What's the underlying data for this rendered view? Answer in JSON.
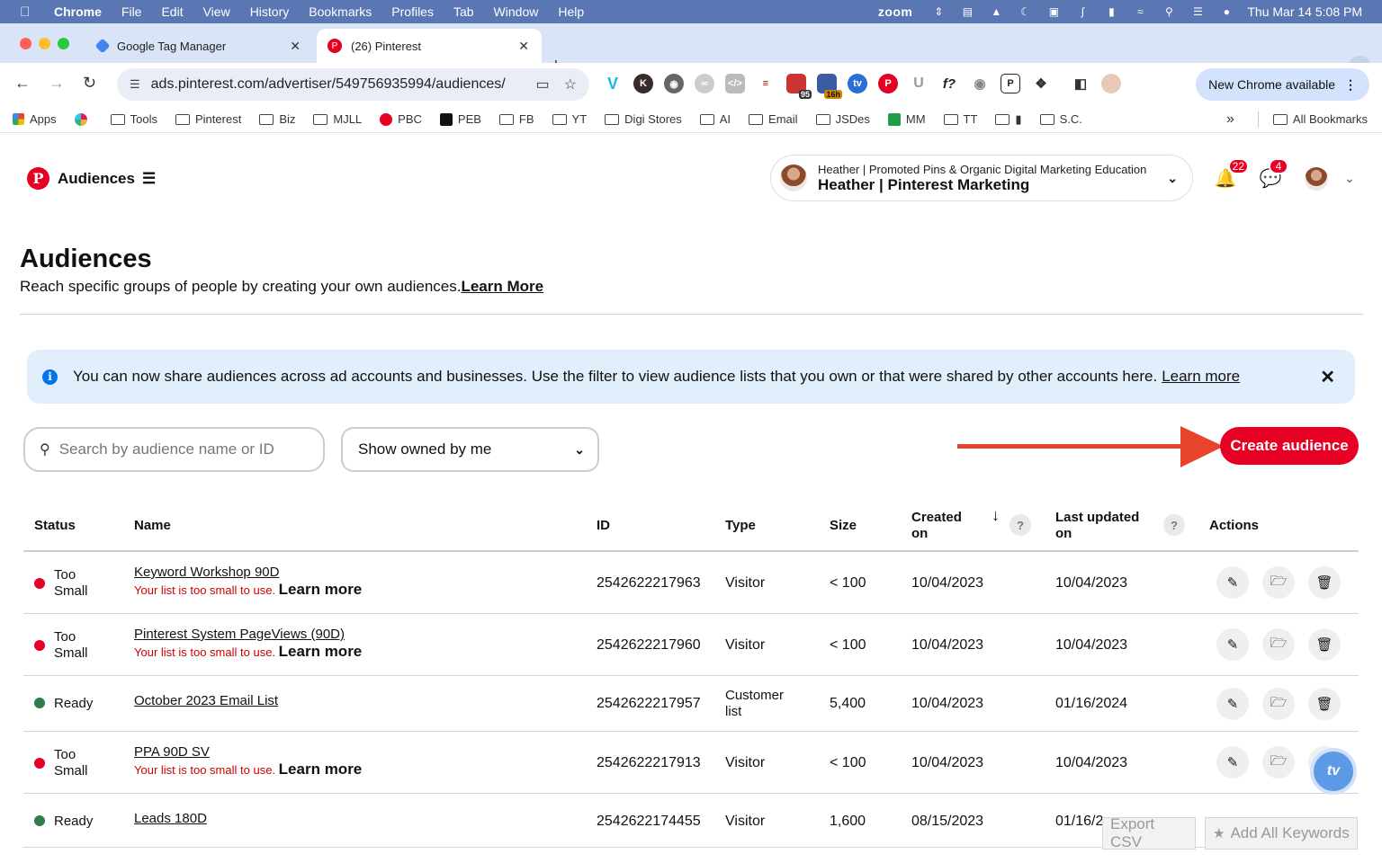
{
  "macbar": {
    "app": "Chrome",
    "menus": [
      "File",
      "Edit",
      "View",
      "History",
      "Bookmarks",
      "Profiles",
      "Tab",
      "Window",
      "Help"
    ],
    "zoom": "zoom",
    "datetime": "Thu Mar 14  5:08 PM"
  },
  "tabs": [
    {
      "title": "Google Tag Manager"
    },
    {
      "title": "(26) Pinterest"
    }
  ],
  "omnibox": {
    "url": "ads.pinterest.com/advertiser/549756935994/audiences/"
  },
  "toolbar": {
    "new_chrome": "New Chrome available",
    "ext_badges": [
      "95",
      "16h"
    ]
  },
  "bookmarks": {
    "items": [
      "Apps",
      "Tools",
      "Pinterest",
      "Biz",
      "MJLL",
      "PBC",
      "PEB",
      "FB",
      "YT",
      "Digi Stores",
      "AI",
      "Email",
      "JSDes",
      "MM",
      "TT",
      "",
      "S.C."
    ],
    "more": "»",
    "all": "All Bookmarks"
  },
  "header": {
    "brand_icon": "P",
    "section": "Audiences",
    "account_line1": "Heather | Promoted Pins & Organic Digital Marketing Education",
    "account_line2": "Heather | Pinterest Marketing",
    "notifications_count": "22",
    "messages_count": "4"
  },
  "page": {
    "title": "Audiences",
    "subtitle": "Reach specific groups of people by creating your own audiences.",
    "subtitle_link": "Learn More"
  },
  "banner": {
    "text": "You can now share audiences across ad accounts and businesses. Use the filter to view audience lists that you own or that were shared by other accounts here.",
    "link": "Learn more"
  },
  "filters": {
    "search_placeholder": "Search by audience name or ID",
    "owner_select": "Show owned by me",
    "create_button": "Create audience"
  },
  "table": {
    "headers": {
      "status": "Status",
      "name": "Name",
      "id": "ID",
      "type": "Type",
      "size": "Size",
      "created_1": "Created",
      "created_2": "on",
      "updated_1": "Last updated",
      "updated_2": "on",
      "actions": "Actions"
    },
    "error_text": "Your list is too small to use.",
    "error_link": "Learn more",
    "rows": [
      {
        "status_1": "Too",
        "status_2": "Small",
        "status_color": "#e60023",
        "name": "Keyword Workshop 90D",
        "id": "2542622217963",
        "type_1": "Visitor",
        "type_2": "",
        "size": "< 100",
        "created": "10/04/2023",
        "updated": "10/04/2023"
      },
      {
        "status_1": "Too",
        "status_2": "Small",
        "status_color": "#e60023",
        "name": "Pinterest System PageViews (90D)",
        "id": "2542622217960",
        "type_1": "Visitor",
        "type_2": "",
        "size": "< 100",
        "created": "10/04/2023",
        "updated": "10/04/2023"
      },
      {
        "status_1": "Ready",
        "status_2": "",
        "status_color": "#2f7d4a",
        "name": "October 2023 Email List",
        "id": "2542622217957",
        "type_1": "Customer",
        "type_2": "list",
        "size": "5,400",
        "created": "10/04/2023",
        "updated": "01/16/2024"
      },
      {
        "status_1": "Too",
        "status_2": "Small",
        "status_color": "#e60023",
        "name": "PPA 90D SV",
        "id": "2542622217913",
        "type_1": "Visitor",
        "type_2": "",
        "size": "< 100",
        "created": "10/04/2023",
        "updated": "10/04/2023"
      },
      {
        "status_1": "Ready",
        "status_2": "",
        "status_color": "#2f7d4a",
        "name": "Leads 180D",
        "id": "2542622174455",
        "type_1": "Visitor",
        "type_2": "",
        "size": "1,600",
        "created": "08/15/2023",
        "updated": "01/16/2"
      }
    ]
  },
  "overlay": {
    "export_csv": "Export CSV",
    "add_keywords": "Add All Keywords",
    "star": "★",
    "bubble": "tv"
  }
}
